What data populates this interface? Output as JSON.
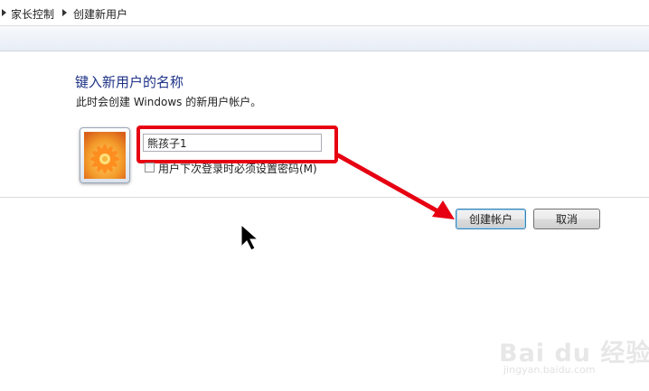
{
  "breadcrumb": {
    "items": [
      "家长控制",
      "创建新用户"
    ]
  },
  "main": {
    "title": "键入新用户的名称",
    "subtitle": "此时会创建 Windows 的新用户帐户。",
    "username_value": "熊孩子1",
    "checkbox_label": "用户下次登录时必须设置密码(M)",
    "checkbox_checked": false
  },
  "buttons": {
    "create_label": "创建帐户",
    "cancel_label": "取消"
  },
  "annotation": {
    "color": "#e60012"
  },
  "watermark": {
    "text": "Bai du 经验",
    "subtext": "jingyan.baidu.com"
  },
  "icons": {
    "breadcrumb_separator": "chevron-right-icon",
    "avatar": "flower-avatar-icon",
    "cursor": "mouse-pointer-icon"
  }
}
